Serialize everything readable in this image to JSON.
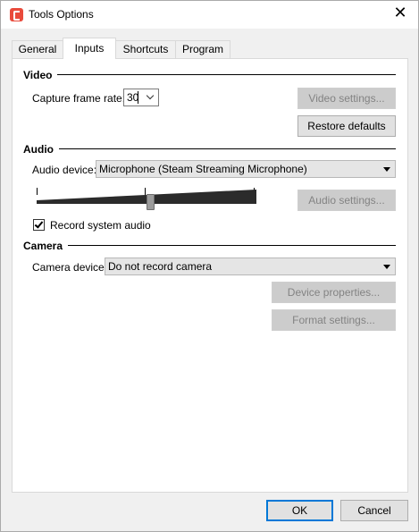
{
  "window": {
    "title": "Tools Options",
    "close_glyph": "✕"
  },
  "tabs": [
    {
      "label": "General",
      "active": false
    },
    {
      "label": "Inputs",
      "active": true
    },
    {
      "label": "Shortcuts",
      "active": false
    },
    {
      "label": "Program",
      "active": false
    }
  ],
  "video": {
    "heading": "Video",
    "capture_frame_rate_label": "Capture frame rate:",
    "capture_frame_rate_value": "30",
    "video_settings_label": "Video settings...",
    "restore_defaults_label": "Restore defaults"
  },
  "audio": {
    "heading": "Audio",
    "audio_device_label": "Audio device:",
    "audio_device_value": "Microphone (Steam Streaming Microphone)",
    "audio_settings_label": "Audio settings...",
    "volume_level": 0.52,
    "record_system_audio_label": "Record system audio",
    "record_system_audio_checked": true
  },
  "camera": {
    "heading": "Camera",
    "camera_device_label": "Camera device:",
    "camera_device_value": "Do not record camera",
    "device_properties_label": "Device properties...",
    "format_settings_label": "Format settings..."
  },
  "footer": {
    "ok_label": "OK",
    "cancel_label": "Cancel"
  },
  "colors": {
    "app_icon": "#e94b3c",
    "focus_blue": "#0078d7",
    "panel_bg": "#ffffff",
    "window_bg": "#f0f0f0"
  },
  "icons": {
    "app": "camtasia-app-icon",
    "close": "close-icon",
    "dropdown": "chevron-down-icon",
    "check": "checkmark-icon"
  }
}
